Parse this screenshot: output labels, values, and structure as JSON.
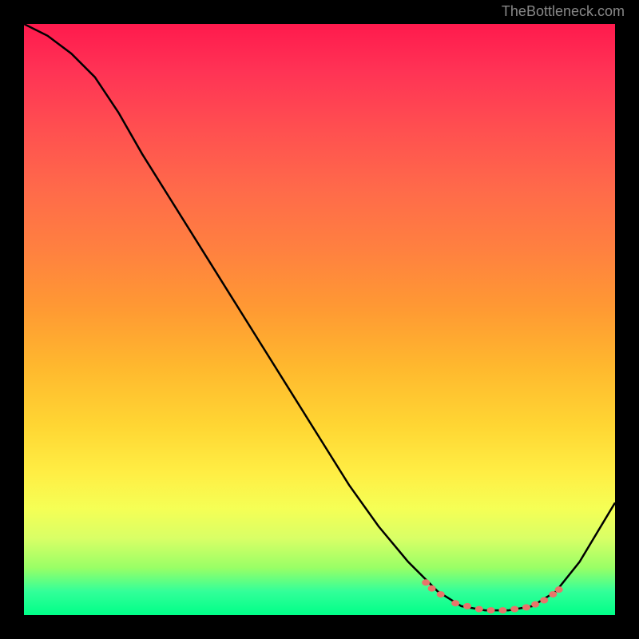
{
  "watermark": "TheBottleneck.com",
  "chart_data": {
    "type": "line",
    "title": "",
    "xlabel": "",
    "ylabel": "",
    "xlim": [
      0,
      100
    ],
    "ylim": [
      0,
      100
    ],
    "curve_points": [
      {
        "x": 0,
        "y": 100
      },
      {
        "x": 4,
        "y": 98
      },
      {
        "x": 8,
        "y": 95
      },
      {
        "x": 12,
        "y": 91
      },
      {
        "x": 16,
        "y": 85
      },
      {
        "x": 20,
        "y": 78
      },
      {
        "x": 25,
        "y": 70
      },
      {
        "x": 30,
        "y": 62
      },
      {
        "x": 35,
        "y": 54
      },
      {
        "x": 40,
        "y": 46
      },
      {
        "x": 45,
        "y": 38
      },
      {
        "x": 50,
        "y": 30
      },
      {
        "x": 55,
        "y": 22
      },
      {
        "x": 60,
        "y": 15
      },
      {
        "x": 65,
        "y": 9
      },
      {
        "x": 70,
        "y": 4
      },
      {
        "x": 74,
        "y": 1.5
      },
      {
        "x": 78,
        "y": 0.8
      },
      {
        "x": 82,
        "y": 0.8
      },
      {
        "x": 86,
        "y": 1.5
      },
      {
        "x": 90,
        "y": 4
      },
      {
        "x": 94,
        "y": 9
      },
      {
        "x": 97,
        "y": 14
      },
      {
        "x": 100,
        "y": 19
      }
    ],
    "marker_points": [
      {
        "x": 68,
        "y": 5.5
      },
      {
        "x": 69,
        "y": 4.5
      },
      {
        "x": 70.5,
        "y": 3.5
      },
      {
        "x": 73,
        "y": 2
      },
      {
        "x": 75,
        "y": 1.5
      },
      {
        "x": 77,
        "y": 1
      },
      {
        "x": 79,
        "y": 0.8
      },
      {
        "x": 81,
        "y": 0.8
      },
      {
        "x": 83,
        "y": 1
      },
      {
        "x": 85,
        "y": 1.3
      },
      {
        "x": 86.5,
        "y": 1.8
      },
      {
        "x": 88,
        "y": 2.5
      },
      {
        "x": 89.5,
        "y": 3.5
      },
      {
        "x": 90.5,
        "y": 4.3
      }
    ],
    "marker_color": "#e8746a"
  }
}
